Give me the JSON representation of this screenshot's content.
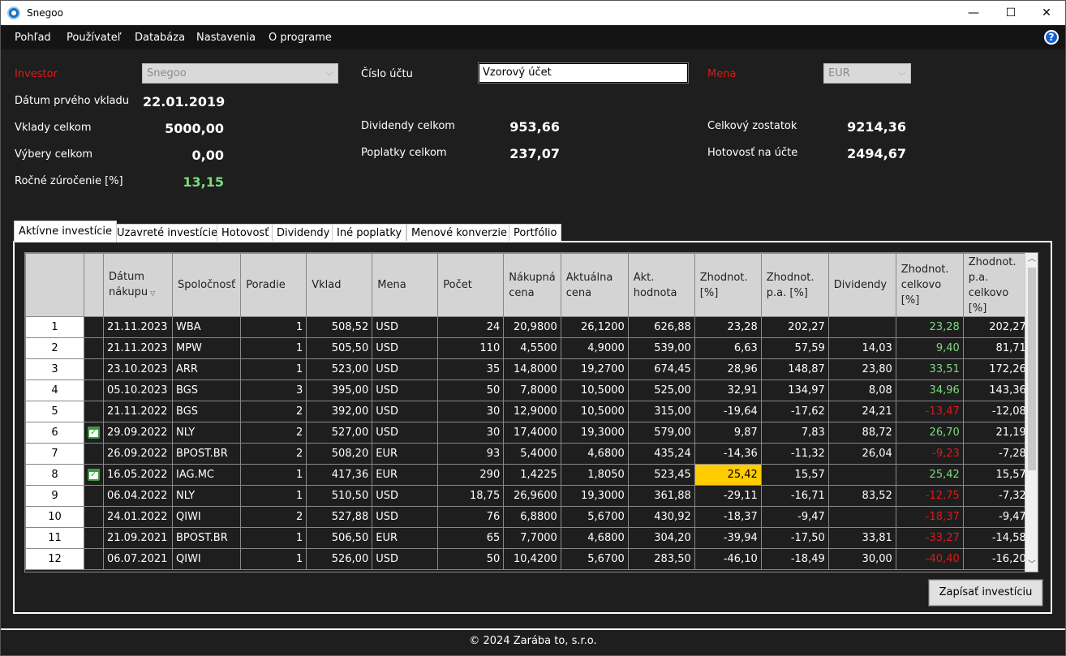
{
  "window": {
    "title": "Snegoo",
    "min": "—",
    "max": "☐",
    "close": "✕"
  },
  "menu": [
    "Pohľad",
    "Používateľ",
    "Databáza",
    "Nastavenia",
    "O programe"
  ],
  "help": "?",
  "summary": {
    "investor_label": "Investor",
    "investor_value": "Snegoo",
    "account_label": "Číslo účtu",
    "account_value": "Vzorový účet",
    "currency_label": "Mena",
    "currency_value": "EUR",
    "first_deposit_label": "Dátum prvého vkladu",
    "first_deposit_value": "22.01.2019",
    "deposits_label": "Vklady celkom",
    "deposits_value": "5000,00",
    "withdrawals_label": "Výbery celkom",
    "withdrawals_value": "0,00",
    "annual_label": "Ročné zúročenie [%]",
    "annual_value": "13,15",
    "dividends_label": "Dividendy celkom",
    "dividends_value": "953,66",
    "fees_label": "Poplatky celkom",
    "fees_value": "237,07",
    "balance_label": "Celkový zostatok",
    "balance_value": "9214,36",
    "cash_label": "Hotovosť na účte",
    "cash_value": "2494,67"
  },
  "tabs": [
    "Aktívne investície",
    "Uzavreté investície",
    "Hotovosť",
    "Dividendy",
    "Iné poplatky",
    "Menové konverzie",
    "Portfólio"
  ],
  "columns": [
    "",
    "",
    "Dátum nákupu",
    "Spoločnosť",
    "Poradie",
    "Vklad",
    "Mena",
    "Počet",
    "Nákupná cena",
    "Aktuálna cena",
    "Akt. hodnota",
    "Zhodnot. [%]",
    "Zhodnot. p.a. [%]",
    "Dividendy",
    "Zhodnot. celkovo [%]",
    "Zhodnot. p.a. celkovo [%]"
  ],
  "rows": [
    {
      "n": "1",
      "cal": false,
      "date": "21.11.2023",
      "company": "WBA",
      "order": "1",
      "deposit": "508,52",
      "cur": "USD",
      "count": "24",
      "buy": "20,9800",
      "price": "26,1200",
      "value": "626,88",
      "gain": "23,28",
      "gain_pa": "202,27",
      "div": "",
      "total": "23,28",
      "total_pa": "202,27",
      "total_color": "pos",
      "hl": false
    },
    {
      "n": "2",
      "cal": false,
      "date": "21.11.2023",
      "company": "MPW",
      "order": "1",
      "deposit": "505,50",
      "cur": "USD",
      "count": "110",
      "buy": "4,5500",
      "price": "4,9000",
      "value": "539,00",
      "gain": "6,63",
      "gain_pa": "57,59",
      "div": "14,03",
      "total": "9,40",
      "total_pa": "81,71",
      "total_color": "pos",
      "hl": false
    },
    {
      "n": "3",
      "cal": false,
      "date": "23.10.2023",
      "company": "ARR",
      "order": "1",
      "deposit": "523,00",
      "cur": "USD",
      "count": "35",
      "buy": "14,8000",
      "price": "19,2700",
      "value": "674,45",
      "gain": "28,96",
      "gain_pa": "148,87",
      "div": "23,80",
      "total": "33,51",
      "total_pa": "172,26",
      "total_color": "pos",
      "hl": false
    },
    {
      "n": "4",
      "cal": false,
      "date": "05.10.2023",
      "company": "BGS",
      "order": "3",
      "deposit": "395,00",
      "cur": "USD",
      "count": "50",
      "buy": "7,8000",
      "price": "10,5000",
      "value": "525,00",
      "gain": "32,91",
      "gain_pa": "134,97",
      "div": "8,08",
      "total": "34,96",
      "total_pa": "143,36",
      "total_color": "pos",
      "hl": false
    },
    {
      "n": "5",
      "cal": false,
      "date": "21.11.2022",
      "company": "BGS",
      "order": "2",
      "deposit": "392,00",
      "cur": "USD",
      "count": "30",
      "buy": "12,9000",
      "price": "10,5000",
      "value": "315,00",
      "gain": "-19,64",
      "gain_pa": "-17,62",
      "div": "24,21",
      "total": "-13,47",
      "total_pa": "-12,08",
      "total_color": "neg",
      "hl": false
    },
    {
      "n": "6",
      "cal": true,
      "date": "29.09.2022",
      "company": "NLY",
      "order": "2",
      "deposit": "527,00",
      "cur": "USD",
      "count": "30",
      "buy": "17,4000",
      "price": "19,3000",
      "value": "579,00",
      "gain": "9,87",
      "gain_pa": "7,83",
      "div": "88,72",
      "total": "26,70",
      "total_pa": "21,19",
      "total_color": "pos",
      "hl": false
    },
    {
      "n": "7",
      "cal": false,
      "date": "26.09.2022",
      "company": "BPOST.BR",
      "order": "2",
      "deposit": "508,20",
      "cur": "EUR",
      "count": "93",
      "buy": "5,4000",
      "price": "4,6800",
      "value": "435,24",
      "gain": "-14,36",
      "gain_pa": "-11,32",
      "div": "26,04",
      "total": "-9,23",
      "total_pa": "-7,28",
      "total_color": "neg",
      "hl": false
    },
    {
      "n": "8",
      "cal": true,
      "date": "16.05.2022",
      "company": "IAG.MC",
      "order": "1",
      "deposit": "417,36",
      "cur": "EUR",
      "count": "290",
      "buy": "1,4225",
      "price": "1,8050",
      "value": "523,45",
      "gain": "25,42",
      "gain_pa": "15,57",
      "div": "",
      "total": "25,42",
      "total_pa": "15,57",
      "total_color": "pos",
      "hl": true
    },
    {
      "n": "9",
      "cal": false,
      "date": "06.04.2022",
      "company": "NLY",
      "order": "1",
      "deposit": "510,50",
      "cur": "USD",
      "count": "18,75",
      "buy": "26,9600",
      "price": "19,3000",
      "value": "361,88",
      "gain": "-29,11",
      "gain_pa": "-16,71",
      "div": "83,52",
      "total": "-12,75",
      "total_pa": "-7,32",
      "total_color": "neg",
      "hl": false
    },
    {
      "n": "10",
      "cal": false,
      "date": "24.01.2022",
      "company": "QIWI",
      "order": "2",
      "deposit": "527,88",
      "cur": "USD",
      "count": "76",
      "buy": "6,8800",
      "price": "5,6700",
      "value": "430,92",
      "gain": "-18,37",
      "gain_pa": "-9,47",
      "div": "",
      "total": "-18,37",
      "total_pa": "-9,47",
      "total_color": "neg",
      "hl": false
    },
    {
      "n": "11",
      "cal": false,
      "date": "21.09.2021",
      "company": "BPOST.BR",
      "order": "1",
      "deposit": "506,50",
      "cur": "EUR",
      "count": "65",
      "buy": "7,7000",
      "price": "4,6800",
      "value": "304,20",
      "gain": "-39,94",
      "gain_pa": "-17,50",
      "div": "33,81",
      "total": "-33,27",
      "total_pa": "-14,58",
      "total_color": "neg",
      "hl": false
    },
    {
      "n": "12",
      "cal": false,
      "date": "06.07.2021",
      "company": "QIWI",
      "order": "1",
      "deposit": "526,00",
      "cur": "USD",
      "count": "50",
      "buy": "10,4200",
      "price": "5,6700",
      "value": "283,50",
      "gain": "-46,10",
      "gain_pa": "-18,49",
      "div": "30,00",
      "total": "-40,40",
      "total_pa": "-16,20",
      "total_color": "neg",
      "hl": false
    }
  ],
  "save_button": "Zapísať investíciu",
  "footer": "© 2024 Zarába to, s.r.o.",
  "colors": {
    "positive": "#7ddc7d",
    "negative": "#e01818",
    "highlight": "#ffcc00",
    "label_red": "#e01818"
  }
}
